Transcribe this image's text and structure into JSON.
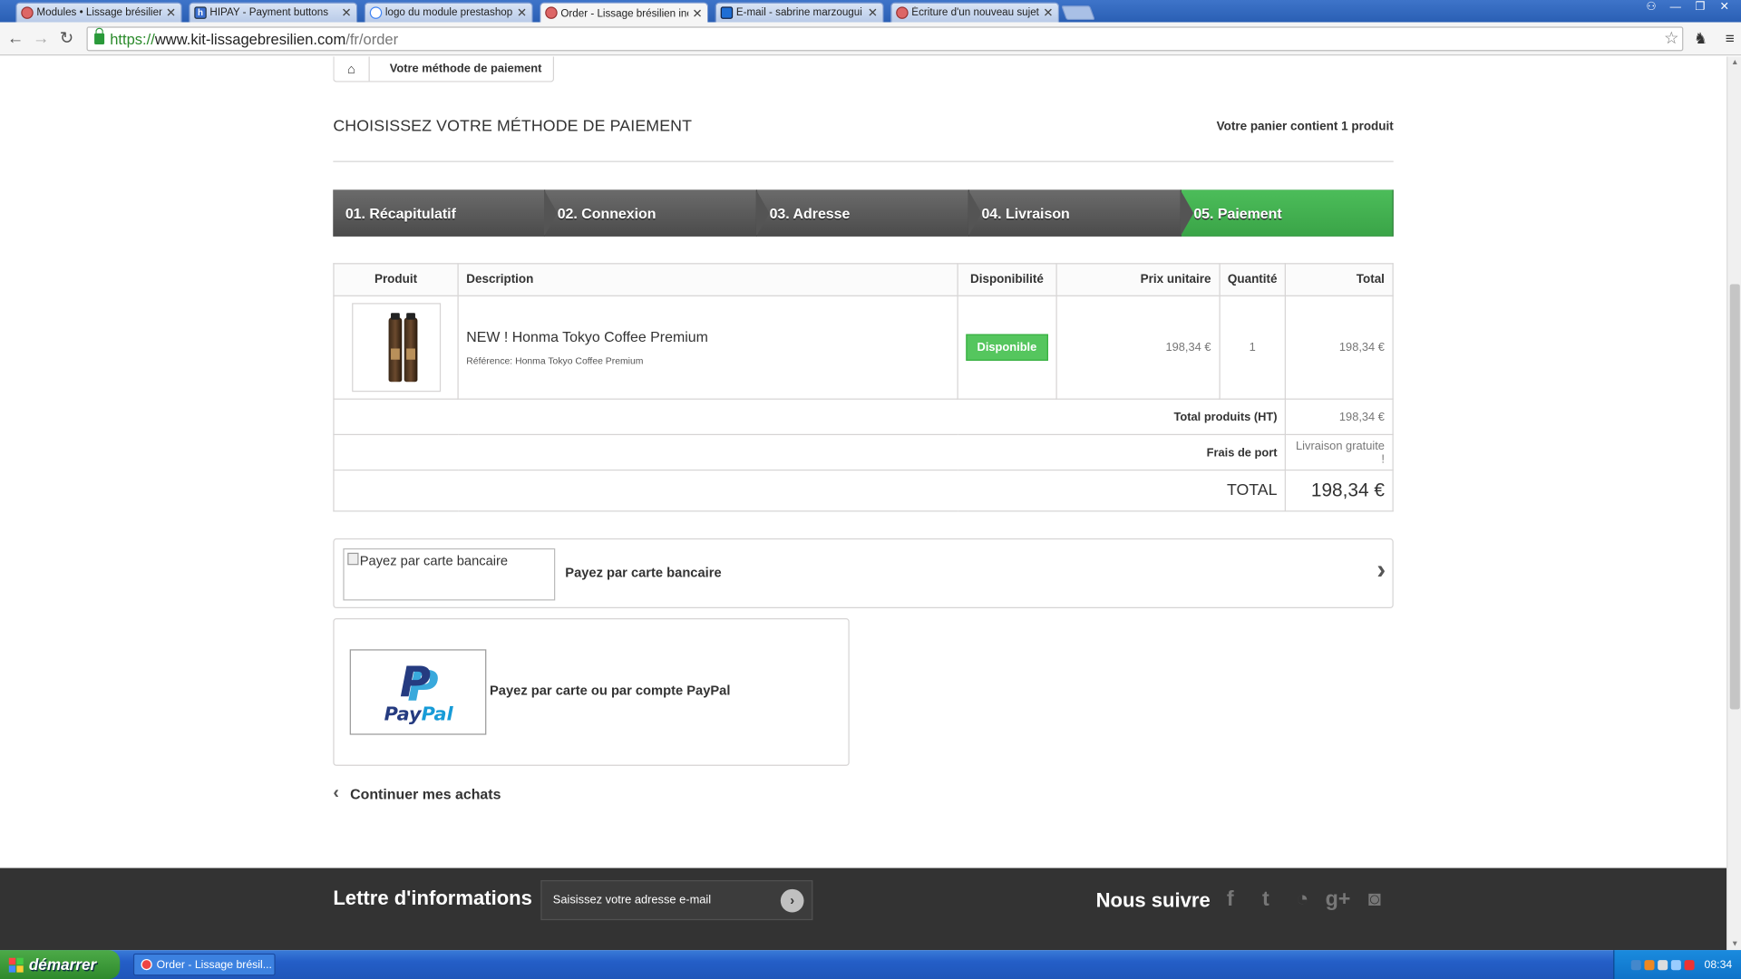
{
  "browser": {
    "tabs": [
      {
        "title": "Modules • Lissage brésilien in",
        "icon": "site-favicon"
      },
      {
        "title": "HIPAY - Payment buttons",
        "icon": "hipay-favicon"
      },
      {
        "title": "logo du module prestashop a",
        "icon": "google-favicon"
      },
      {
        "title": "Order - Lissage brésilien inoa",
        "icon": "site-favicon",
        "active": true
      },
      {
        "title": "E-mail - sabrine marzougui - C",
        "icon": "outlook-favicon"
      },
      {
        "title": "Écriture d'un nouveau sujet",
        "icon": "site-favicon"
      }
    ],
    "url_scheme": "https://",
    "url_host": "www.kit-lissagebresilien.com",
    "url_path": "/fr/order"
  },
  "breadcrumb": {
    "current": "Votre méthode de paiement"
  },
  "page": {
    "title": "CHOISISSEZ VOTRE MÉTHODE DE PAIEMENT",
    "cart_summary": "Votre panier contient 1 produit"
  },
  "steps": [
    "01. Récapitulatif",
    "02. Connexion",
    "03. Adresse",
    "04. Livraison",
    "05. Paiement"
  ],
  "cart": {
    "headers": {
      "product": "Produit",
      "description": "Description",
      "availability": "Disponibilité",
      "unit_price": "Prix unitaire",
      "quantity": "Quantité",
      "total": "Total"
    },
    "item": {
      "name": "NEW ! Honma Tokyo Coffee Premium",
      "reference": "Référence: Honma Tokyo Coffee Premium",
      "availability": "Disponible",
      "unit_price": "198,34 €",
      "quantity": "1",
      "total": "198,34 €"
    },
    "total_products_label": "Total produits (HT)",
    "total_products": "198,34 €",
    "shipping_label": "Frais de port",
    "shipping": "Livraison gratuite !",
    "total_label": "TOTAL",
    "total": "198,34 €"
  },
  "payment": {
    "card_alt": "Payez par carte bancaire",
    "card_label": "Payez par carte bancaire",
    "paypal_label": "Payez par carte ou par compte PayPal",
    "paypal_logo_letter": "P",
    "paypal_logo_pay": "Pay",
    "paypal_logo_pal": "Pal"
  },
  "continue_label": "Continuer mes achats",
  "footer": {
    "newsletter_title": "Lettre d'informations",
    "newsletter_placeholder": "Saisissez votre adresse e-mail",
    "follow_title": "Nous suivre"
  },
  "taskbar": {
    "start_label": "démarrer",
    "task_title": "Order - Lissage brésil...",
    "clock": "08:34"
  },
  "colors": {
    "accent_green": "#46b450",
    "step_dark": "#555555",
    "footer_bg": "#333333"
  }
}
